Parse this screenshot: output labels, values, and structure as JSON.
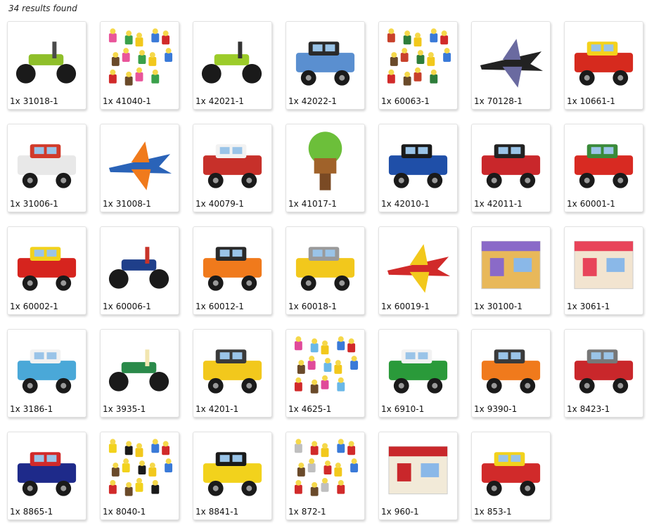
{
  "header": {
    "results_text": "34 results found"
  },
  "items": [
    {
      "qty": "1x",
      "set": "31018-1",
      "icon": "motorcycle-icon",
      "color": "#8fbf2a",
      "accent": "#4a4a4a"
    },
    {
      "qty": "1x",
      "set": "41040-1",
      "icon": "advent-minifigs-icon",
      "color": "#e9559a",
      "accent": "#3aa04a"
    },
    {
      "qty": "1x",
      "set": "42021-1",
      "icon": "snowmobile-icon",
      "color": "#9ccc2a",
      "accent": "#333333"
    },
    {
      "qty": "1x",
      "set": "42022-1",
      "icon": "hot-rod-icon",
      "color": "#5a8fd0",
      "accent": "#2a2a2a"
    },
    {
      "qty": "1x",
      "set": "60063-1",
      "icon": "advent-minifigs-icon",
      "color": "#c8412b",
      "accent": "#2e7d3a"
    },
    {
      "qty": "1x",
      "set": "70128-1",
      "icon": "bat-glider-icon",
      "color": "#222222",
      "accent": "#6a6aa0"
    },
    {
      "qty": "1x",
      "set": "10661-1",
      "icon": "fire-truck-icon",
      "color": "#d62a1e",
      "accent": "#f4d21c"
    },
    {
      "qty": "1x",
      "set": "31006-1",
      "icon": "sports-car-icon",
      "color": "#e8e8e8",
      "accent": "#d13a2a"
    },
    {
      "qty": "1x",
      "set": "31008-1",
      "icon": "jet-plane-icon",
      "color": "#2a63b8",
      "accent": "#f07a1c"
    },
    {
      "qty": "1x",
      "set": "40079-1",
      "icon": "camper-van-icon",
      "color": "#c7302a",
      "accent": "#f2f2f2"
    },
    {
      "qty": "1x",
      "set": "41017-1",
      "icon": "tree-house-icon",
      "color": "#7a4a24",
      "accent": "#6cbf3a"
    },
    {
      "qty": "1x",
      "set": "42010-1",
      "icon": "off-road-racer-icon",
      "color": "#1f4fa8",
      "accent": "#1a1a1a"
    },
    {
      "qty": "1x",
      "set": "42011-1",
      "icon": "race-car-icon",
      "color": "#c9272b",
      "accent": "#222222"
    },
    {
      "qty": "1x",
      "set": "60001-1",
      "icon": "fire-chief-car-icon",
      "color": "#d82a22",
      "accent": "#3a8a3a"
    },
    {
      "qty": "1x",
      "set": "60002-1",
      "icon": "fire-truck-icon",
      "color": "#d6241e",
      "accent": "#f2d21c"
    },
    {
      "qty": "1x",
      "set": "60006-1",
      "icon": "police-atv-icon",
      "color": "#1f3f8a",
      "accent": "#c8342a"
    },
    {
      "qty": "1x",
      "set": "60012-1",
      "icon": "coast-guard-icon",
      "color": "#f07a1c",
      "accent": "#2a2a2a"
    },
    {
      "qty": "1x",
      "set": "60018-1",
      "icon": "cement-mixer-icon",
      "color": "#f2c81c",
      "accent": "#9a9a9a"
    },
    {
      "qty": "1x",
      "set": "60019-1",
      "icon": "stunt-plane-icon",
      "color": "#d12a2a",
      "accent": "#f2c81c"
    },
    {
      "qty": "1x",
      "set": "30100-1",
      "icon": "friends-beach-icon",
      "color": "#8a6ac8",
      "accent": "#e8b85a"
    },
    {
      "qty": "1x",
      "set": "3061-1",
      "icon": "city-cafe-icon",
      "color": "#e8445a",
      "accent": "#f2e4d0"
    },
    {
      "qty": "1x",
      "set": "3186-1",
      "icon": "horse-trailer-icon",
      "color": "#4aa8d8",
      "accent": "#f2f2f2"
    },
    {
      "qty": "1x",
      "set": "3935-1",
      "icon": "atv-icon",
      "color": "#2a8a4a",
      "accent": "#f2e6b0"
    },
    {
      "qty": "1x",
      "set": "4201-1",
      "icon": "loader-dump-truck-icon",
      "color": "#f2c81c",
      "accent": "#3a3a3a"
    },
    {
      "qty": "1x",
      "set": "4625-1",
      "icon": "creative-bucket-icon",
      "color": "#e04a9a",
      "accent": "#6ab8e8"
    },
    {
      "qty": "1x",
      "set": "6910-1",
      "icon": "mini-sports-car-icon",
      "color": "#2a9a3a",
      "accent": "#f2f2f2"
    },
    {
      "qty": "1x",
      "set": "9390-1",
      "icon": "tow-truck-icon",
      "color": "#f07a1c",
      "accent": "#3a3a3a"
    },
    {
      "qty": "1x",
      "set": "8423-1",
      "icon": "race-track-icon",
      "color": "#c9272b",
      "accent": "#777777"
    },
    {
      "qty": "1x",
      "set": "8865-1",
      "icon": "test-car-icon",
      "color": "#1e2a8a",
      "accent": "#d12a2a"
    },
    {
      "qty": "1x",
      "set": "8040-1",
      "icon": "universal-set-icon",
      "color": "#f2d21c",
      "accent": "#1a1a1a"
    },
    {
      "qty": "1x",
      "set": "8841-1",
      "icon": "dune-buggy-icon",
      "color": "#f2d21c",
      "accent": "#1a1a1a"
    },
    {
      "qty": "1x",
      "set": "872-1",
      "icon": "gear-parts-icon",
      "color": "#bfbfbf",
      "accent": "#d12a2a"
    },
    {
      "qty": "1x",
      "set": "960-1",
      "icon": "power-pack-box-icon",
      "color": "#c9272b",
      "accent": "#f2ead8"
    },
    {
      "qty": "1x",
      "set": "853-1",
      "icon": "car-chassis-icon",
      "color": "#d12a2a",
      "accent": "#f2d21c"
    }
  ]
}
